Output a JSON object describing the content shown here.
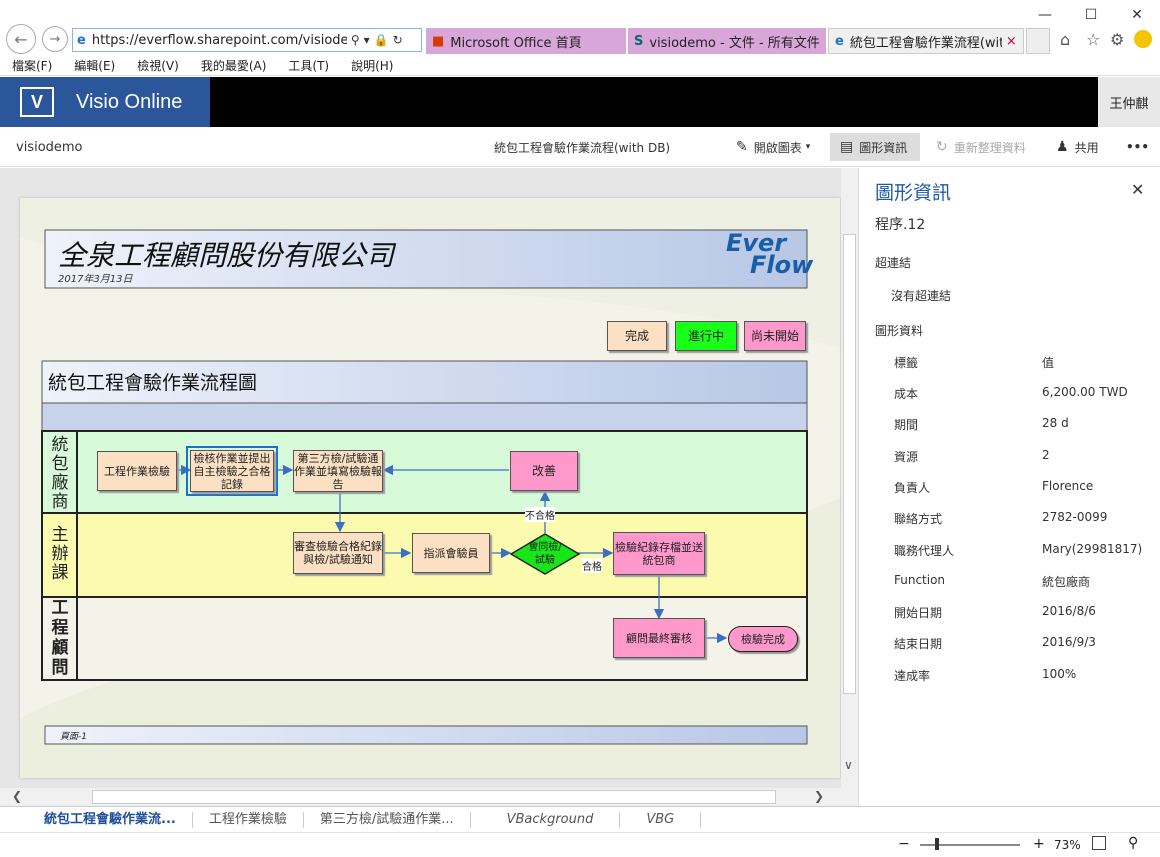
{
  "browser": {
    "url": "https://everflow.sharepoint.com/visiodemo/_",
    "tabs": [
      {
        "label": "Microsoft Office 首頁",
        "color": "#d9a6d9"
      },
      {
        "label": "visiodemo - 文件 - 所有文件",
        "color": "#d9a6d9"
      },
      {
        "label": "統包工程會驗作業流程(wit...",
        "color": "#f0f0f0"
      }
    ],
    "menu": [
      "檔案(F)",
      "編輯(E)",
      "檢視(V)",
      "我的最愛(A)",
      "工具(T)",
      "說明(H)"
    ]
  },
  "app": {
    "brand": "Visio Online",
    "user": "王仲麒",
    "site": "visiodemo",
    "doc_title": "統包工程會驗作業流程(with DB)",
    "toolbar": {
      "open_diagram": "開啟圖表",
      "shape_info": "圖形資訊",
      "refresh": "重新整理資料",
      "share": "共用",
      "more": "•••"
    }
  },
  "diagram": {
    "company": "全泉工程顧問股份有限公司",
    "date": "2017年3月13日",
    "logo_line1": "Ever",
    "logo_line2": "Flow",
    "legend": [
      "完成",
      "進行中",
      "尚未開始"
    ],
    "flow_title": "統包工程會驗作業流程圖",
    "lanes": [
      "統\n包\n廠\n商",
      "主\n辦\n課",
      "工\n程\n顧\n問"
    ],
    "shapes": {
      "s1": "工程作業檢驗",
      "s2": "檢核作業並提出自主檢驗之合格記錄",
      "s3": "第三方檢/試驗通作業並填寫檢驗報告",
      "s4": "改善",
      "s5": "審查檢驗合格紀錄與檢/試驗通知",
      "s6": "指派會驗員",
      "s7": "會同檢/試驗",
      "s8": "檢驗紀錄存檔並送統包商",
      "s9": "顧問最終審核",
      "s10": "檢驗完成"
    },
    "labels": {
      "fail": "不合格",
      "pass": "合格"
    },
    "footer": "頁面-1"
  },
  "pane": {
    "title": "圖形資訊",
    "shape_name": "程序.12",
    "hyperlink_heading": "超連結",
    "no_hyperlink": "沒有超連結",
    "data_heading": "圖形資料",
    "col_label": "標籤",
    "col_value": "值",
    "rows": [
      {
        "k": "成本",
        "v": "6,200.00 TWD"
      },
      {
        "k": "期間",
        "v": "28 d"
      },
      {
        "k": "資源",
        "v": "2"
      },
      {
        "k": "負責人",
        "v": "Florence"
      },
      {
        "k": "聯絡方式",
        "v": "2782-0099"
      },
      {
        "k": "職務代理人",
        "v": "Mary(29981817)"
      },
      {
        "k": "Function",
        "v": "統包廠商"
      },
      {
        "k": "開始日期",
        "v": "2016/8/6"
      },
      {
        "k": "結束日期",
        "v": "2016/9/3"
      },
      {
        "k": "達成率",
        "v": "100%"
      }
    ]
  },
  "sheets": [
    "統包工程會驗作業流...",
    "工程作業檢驗",
    "第三方檢/試驗通作業...",
    "VBackground",
    "VBG"
  ],
  "status": {
    "zoom": "73%",
    "minus": "−",
    "plus": "+"
  }
}
